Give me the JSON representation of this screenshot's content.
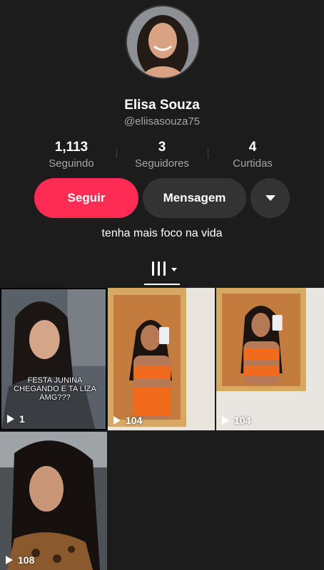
{
  "profile": {
    "name": "Elisa Souza",
    "handle": "@eliisasouza75",
    "bio": "tenha mais foco na vida"
  },
  "stats": [
    {
      "value": "1,113",
      "label": "Seguindo"
    },
    {
      "value": "3",
      "label": "Seguidores"
    },
    {
      "value": "4",
      "label": "Curtidas"
    }
  ],
  "actions": {
    "follow_label": "Seguir",
    "message_label": "Mensagem",
    "more_icon": "caret-down-icon"
  },
  "tabs": {
    "videos_icon": "grid-icon"
  },
  "videos": [
    {
      "views": "1",
      "caption": "FESTA JUNINA CHEGANDO E TA LIZA AMG???"
    },
    {
      "views": "104"
    },
    {
      "views": "104"
    },
    {
      "views": "108"
    }
  ],
  "colors": {
    "background": "#1c1c1c",
    "accent": "#fe2c55",
    "secondary_button": "#333333"
  }
}
